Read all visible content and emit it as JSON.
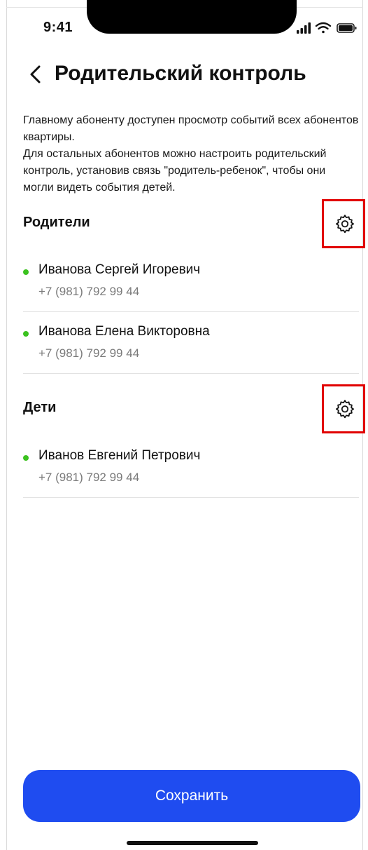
{
  "status_bar": {
    "time": "9:41"
  },
  "header": {
    "title": "Родительский контроль"
  },
  "description": {
    "paragraph_1": "Главному абоненту доступен просмотр событий всех абонентов квартиры.",
    "paragraph_2": "Для остальных абонентов можно настроить родительский контроль, установив связь \"родитель-ребенок\", чтобы они могли видеть события детей."
  },
  "sections": {
    "parents": {
      "title": "Родители",
      "members": [
        {
          "name": "Иванова Сергей Игоревич",
          "phone": "+7 (981) 792 99 44"
        },
        {
          "name": "Иванова Елена Викторовна",
          "phone": "+7 (981) 792 99 44"
        }
      ]
    },
    "children": {
      "title": "Дети",
      "members": [
        {
          "name": "Иванов Евгений Петрович",
          "phone": "+7 (981) 792 99 44"
        }
      ]
    }
  },
  "footer": {
    "save_label": "Сохранить"
  },
  "colors": {
    "accent": "#1f4cf0",
    "online": "#3bc21f",
    "highlight": "#e10000",
    "muted_text": "#7a7a7a"
  },
  "icons": [
    "back-arrow-icon",
    "gear-icon",
    "signal-icon",
    "wifi-icon",
    "battery-icon"
  ]
}
